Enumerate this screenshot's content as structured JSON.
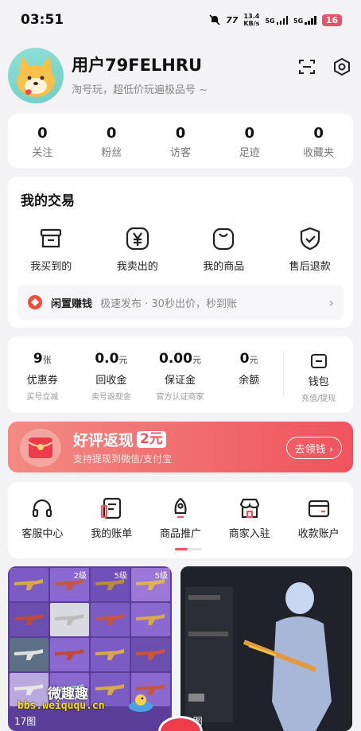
{
  "status_bar": {
    "time": "03:51",
    "speed": "13.4",
    "speed_unit": "KB/s",
    "net1": "5G",
    "net2": "5G",
    "battery": "16"
  },
  "profile": {
    "username": "用户79FELHRU",
    "slogan": "淘号玩，超低价玩遍极品号 ~"
  },
  "stats": [
    {
      "value": "0",
      "label": "关注"
    },
    {
      "value": "0",
      "label": "粉丝"
    },
    {
      "value": "0",
      "label": "访客"
    },
    {
      "value": "0",
      "label": "足迹"
    },
    {
      "value": "0",
      "label": "收藏夹"
    }
  ],
  "trade": {
    "title": "我的交易",
    "items": [
      "我买到的",
      "我卖出的",
      "我的商品",
      "售后退款"
    ],
    "idle_bar": {
      "title": "闲置赚钱",
      "desc": "极速发布 · 30秒出价，秒到账"
    }
  },
  "wallet": [
    {
      "value": "9",
      "unit": "张",
      "label": "优惠券",
      "sub": "买号立减"
    },
    {
      "value": "0.0",
      "unit": "元",
      "label": "回收金",
      "sub": "卖号返现金"
    },
    {
      "value": "0.00",
      "unit": "元",
      "label": "保证金",
      "sub": "官方认证商家"
    },
    {
      "value": "0",
      "unit": "元",
      "label": "余额",
      "sub": ""
    }
  ],
  "wallet_btn": {
    "label": "钱包",
    "sub": "充值/提现"
  },
  "banner": {
    "title": "好评返现",
    "amount": "2元",
    "subtitle": "支持提现到微信/支付宝",
    "button": "去领钱 ›"
  },
  "services": [
    "客服中心",
    "我的账单",
    "商品推广",
    "商家入驻",
    "收款账户"
  ],
  "listings": [
    {
      "levels": [
        "2级",
        "5级",
        "5级"
      ],
      "count": "17图"
    },
    {
      "count": "1图"
    }
  ],
  "watermark": {
    "line1": "微趣趣",
    "line2": "bbs.weiququ.cn"
  },
  "colors": {
    "accent": "#f0535d",
    "page_bg": "#f3f3f5"
  }
}
